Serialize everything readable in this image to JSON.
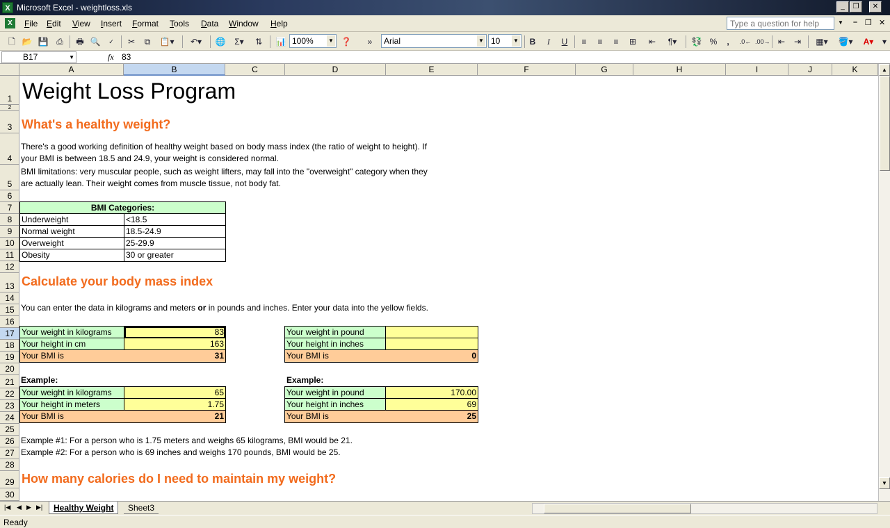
{
  "window": {
    "title": "Microsoft Excel - weightloss.xls",
    "app_icon": "X"
  },
  "menu": [
    "File",
    "Edit",
    "View",
    "Insert",
    "Format",
    "Tools",
    "Data",
    "Window",
    "Help"
  ],
  "help": {
    "placeholder": "Type a question for help"
  },
  "toolbar": {
    "zoom": "100%",
    "font": "Arial",
    "size": "10"
  },
  "formula_bar": {
    "name_box": "B17",
    "fx": "fx",
    "value": "83"
  },
  "columns": [
    "A",
    "B",
    "C",
    "D",
    "E",
    "F",
    "G",
    "H",
    "I",
    "J",
    "K"
  ],
  "selected_column": "B",
  "rows": [
    "1",
    "2",
    "3",
    "4",
    "5",
    "6",
    "7",
    "8",
    "9",
    "10",
    "11",
    "12",
    "13",
    "14",
    "15",
    "16",
    "17",
    "18",
    "19",
    "20",
    "21",
    "22",
    "23",
    "24",
    "25",
    "26",
    "27",
    "28",
    "29",
    "30"
  ],
  "selected_row": "17",
  "content": {
    "title": "Weight Loss Program",
    "h_healthy": "What's a healthy weight?",
    "p4a": "There's a good working definition of healthy weight based on body mass index (the ratio of weight to height). If",
    "p4b": "your BMI is between 18.5 and 24.9, your weight is considered normal.",
    "p5a": "BMI limitations: very muscular people, such as weight lifters, may fall into the \"overweight\" category when they",
    "p5b": "are actually lean. Their weight comes from muscle tissue, not body fat.",
    "bmi_table": {
      "header": "BMI Categories:",
      "rows": [
        {
          "cat": "Underweight",
          "range": "<18.5"
        },
        {
          "cat": "Normal weight",
          "range": "18.5-24.9"
        },
        {
          "cat": "Overweight",
          "range": "25-29.9"
        },
        {
          "cat": "Obesity",
          "range": "30 or greater"
        }
      ]
    },
    "h_calc": "Calculate your body mass index",
    "p15a": "You can enter the data in kilograms and meters ",
    "p15or": "or",
    "p15b": " in pounds and inches. Enter your data into the yellow fields.",
    "metric": {
      "w_label": "Your weight in kilograms",
      "w": "83",
      "h_label": "Your height in cm",
      "h": "163",
      "bmi_label": "Your BMI is",
      "bmi": "31"
    },
    "imperial": {
      "w_label": "Your weight in pound",
      "w": "",
      "h_label": "Your height in inches",
      "h": "",
      "bmi_label": "Your BMI is",
      "bmi": "0"
    },
    "example_label": "Example:",
    "ex_metric": {
      "w_label": "Your weight in kilograms",
      "w": "65",
      "h_label": "Your height in meters",
      "h": "1.75",
      "bmi_label": "Your BMI is",
      "bmi": "21"
    },
    "ex_imperial": {
      "w_label": "Your weight in pound",
      "w": "170.00",
      "h_label": "Your height in inches",
      "h": "69",
      "bmi_label": "Your BMI is",
      "bmi": "25"
    },
    "ex1": "Example #1: For a person who is 1.75 meters and weighs 65 kilograms, BMI would be 21.",
    "ex2": "Example #2: For a person who is 69 inches and weighs 170 pounds, BMI would be 25.",
    "h_cal": "How many calories do I need to maintain my weight?"
  },
  "tabs": {
    "active": "Healthy Weight",
    "other": "Sheet3"
  },
  "status": "Ready",
  "colors": {
    "green": "#ccffcc",
    "yellow": "#ffff99",
    "orange": "#ffcc99",
    "heading": "#f26b1d"
  }
}
